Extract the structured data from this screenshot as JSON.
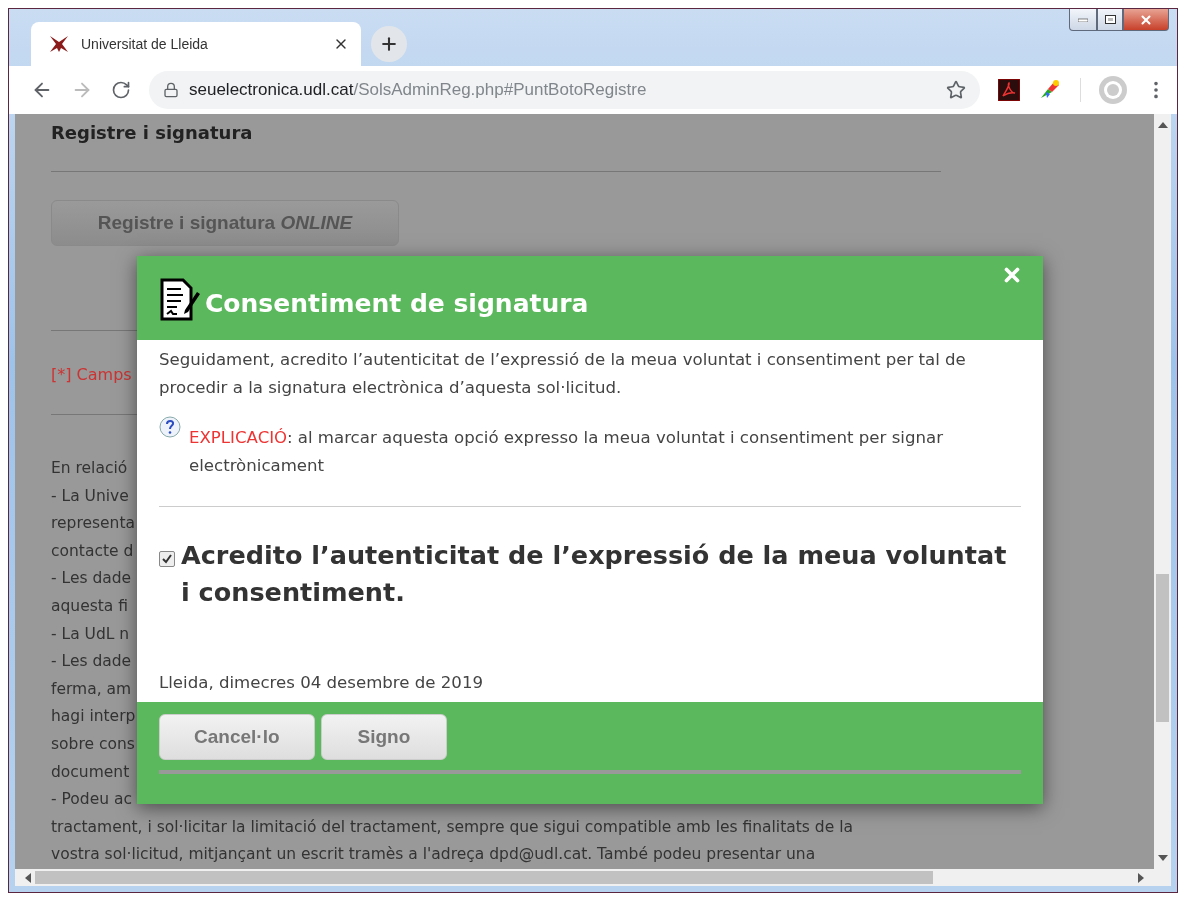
{
  "browser": {
    "tabs": [
      {
        "title": "Universitat de Lleida",
        "selected": true
      }
    ],
    "address": {
      "host": "seuelectronica.udl.cat",
      "path": "/SolsAdminReg.php#PuntBotoRegistre"
    }
  },
  "page": {
    "heading": "Registre i signatura",
    "online_button": "Registre i signatura *ONLINE*",
    "required_note": "[*] Camps",
    "lines": [
      "En relació",
      "- La Unive",
      "representa",
      "contacte d",
      "- Les dade",
      "aquesta fi",
      "- La UdL n",
      "- Les dade",
      "ferma, am",
      "hagi interp",
      "sobre cons",
      "document",
      "- Podeu ac"
    ],
    "full_lines": [
      "tractament, i sol·licitar la limitació del tractament, sempre que sigui compatible amb les finalitats de la",
      "vostra sol·licitud, mitjançant un escrit tramès a l'adreça dpd@udl.cat. També podeu presentar una"
    ]
  },
  "dialog": {
    "title": "Consentiment de signatura",
    "intro": "Seguidament, acredito l’autenticitat de l’expressió de la meua voluntat i consentiment per tal de procedir a la signatura electrònica d’aquesta sol·licitud.",
    "explanation": {
      "label": "EXPLICACIÓ",
      "text": ": al marcar aquesta opció expresso la meua voluntat i consentiment per signar electrònicament"
    },
    "consent": {
      "label": "Acredito l’autenticitat de l’expressió de la meua voluntat i consentiment.",
      "checked": true
    },
    "date": "Lleida, dimecres 04 desembre de 2019",
    "buttons": [
      "Cancel·lo",
      "Signo"
    ]
  }
}
